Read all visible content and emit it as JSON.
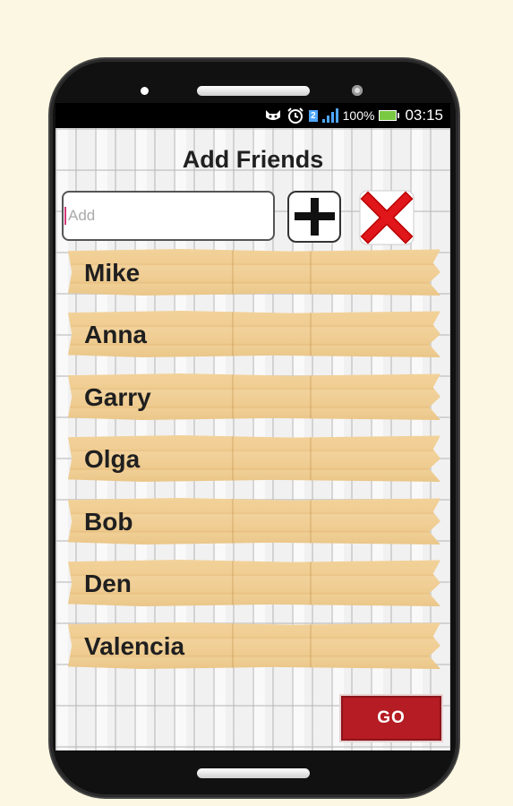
{
  "status_bar": {
    "battery_percent": "100%",
    "time": "03:15",
    "sim_badge": "2",
    "icons": [
      "cat-notification-icon",
      "alarm-clock-icon",
      "sim-icon",
      "signal-bars-icon",
      "battery-icon"
    ]
  },
  "screen": {
    "title": "Add Friends",
    "add_input": {
      "placeholder": "Add",
      "value": ""
    },
    "add_button_icon": "plus-icon",
    "clear_button_icon": "red-x-icon",
    "friends": [
      {
        "name": "Mike"
      },
      {
        "name": "Anna"
      },
      {
        "name": "Garry"
      },
      {
        "name": "Olga"
      },
      {
        "name": "Bob"
      },
      {
        "name": "Den"
      },
      {
        "name": "Valencia"
      }
    ],
    "go_label": "GO"
  },
  "colors": {
    "page_background": "#fcf7e2",
    "plank": "#f0cd92",
    "go_button": "#b51c23",
    "clear_x": "#e0161b"
  }
}
